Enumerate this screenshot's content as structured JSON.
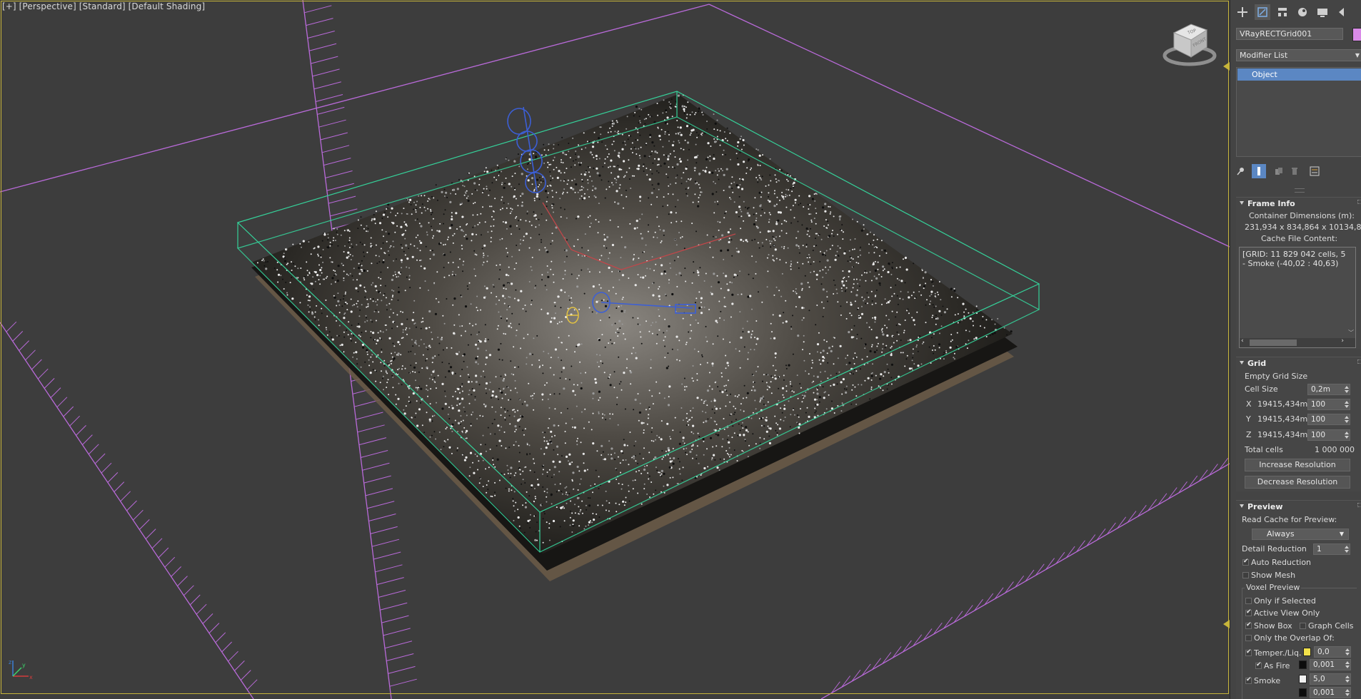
{
  "viewport": {
    "label_parts": [
      "[+]",
      "[Perspective]",
      "[Standard]",
      "[Default Shading]"
    ],
    "viewcube": {
      "top": "TOP",
      "front": "FRONT"
    },
    "axis": {
      "x": "x",
      "y": "y",
      "z": "z"
    }
  },
  "panel": {
    "command_tabs": [
      "create-icon",
      "modify-icon",
      "hierarchy-icon",
      "motion-icon",
      "display-icon",
      "utilities-icon"
    ],
    "object_name": "VRayRECTGrid001",
    "object_color": "#d98be8",
    "modifier_list": "Modifier List",
    "stack_items": [
      "Object"
    ],
    "frame_info": {
      "title": "Frame Info",
      "container_label": "Container Dimensions (m):",
      "container_value": "231,934 x 834,864 x 10134,8",
      "cache_label": "Cache File Content:",
      "cache_lines": [
        "[GRID: 11 829 042 cells, 5",
        "- Smoke (-40,02 : 40,63)"
      ]
    },
    "grid": {
      "title": "Grid",
      "empty_grid_size": "Empty Grid Size",
      "cell_size_label": "Cell Size",
      "cell_size_value": "0,2m",
      "x_label": "X",
      "x_size": "19415,434m",
      "x_value": "100",
      "y_label": "Y",
      "y_size": "19415,434m",
      "y_value": "100",
      "z_label": "Z",
      "z_size": "19415,434m",
      "z_value": "100",
      "total_cells_label": "Total cells",
      "total_cells_value": "1 000 000",
      "increase_button": "Increase Resolution",
      "decrease_button": "Decrease Resolution"
    },
    "preview": {
      "title": "Preview",
      "read_cache_label": "Read Cache for Preview:",
      "read_cache_value": "Always",
      "detail_reduction_label": "Detail Reduction",
      "detail_reduction_value": "1",
      "auto_reduction": "Auto Reduction",
      "show_mesh": "Show Mesh",
      "voxel_preview": "Voxel Preview",
      "only_if_selected": "Only if Selected",
      "active_view_only": "Active View Only",
      "show_box": "Show Box",
      "graph_cells": "Graph Cells",
      "only_overlap": "Only the Overlap Of:",
      "temper_liq": "Temper./Liq.",
      "temper_value": "0,0",
      "as_fire": "As Fire",
      "as_fire_value": "0,001",
      "smoke": "Smoke",
      "smoke_value": "5,0",
      "smoke_value2": "0,001"
    }
  }
}
